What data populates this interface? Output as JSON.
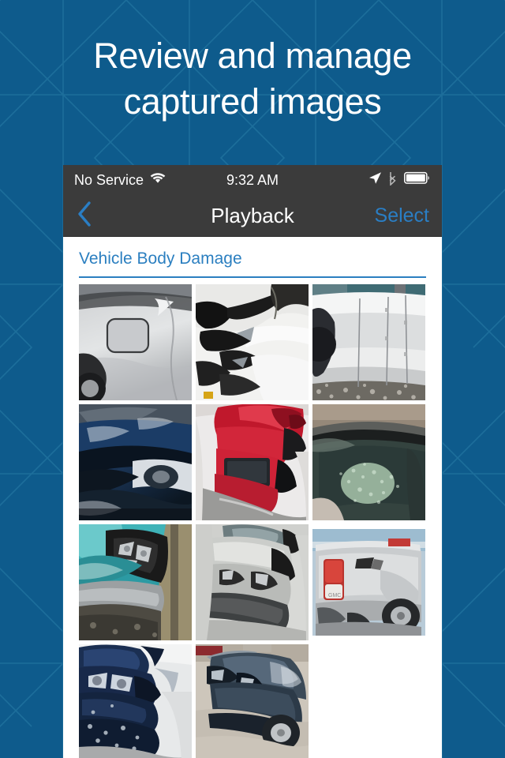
{
  "promo": {
    "headline_line1": "Review and manage",
    "headline_line2": "captured images",
    "background_color": "#0e5b8c",
    "pattern_line_color": "#2a7fa8"
  },
  "phone": {
    "status_bar": {
      "carrier": "No Service",
      "wifi_icon": "wifi-icon",
      "time": "9:32 AM",
      "location_icon": "location-arrow-icon",
      "bluetooth_icon": "bluetooth-icon",
      "battery_icon": "battery-full-icon",
      "background_color": "#3b3b3b"
    },
    "nav_bar": {
      "back_icon": "chevron-left-icon",
      "title": "Playback",
      "action_label": "Select",
      "accent_color": "#2a7ec4"
    },
    "content": {
      "section_title": "Vehicle Body Damage",
      "section_accent": "#2b7fc0",
      "thumbnails": [
        {
          "name": "silver-car-fuel-door-dent",
          "alt": "Silver car rear quarter panel dent near fuel door"
        },
        {
          "name": "white-car-front-crash",
          "alt": "White car severe front-end crash damage"
        },
        {
          "name": "white-car-side-panel-damage",
          "alt": "White vehicle crushed side panels on gravel"
        },
        {
          "name": "blue-car-hood-headlight",
          "alt": "Dark blue car hood and headlight damage"
        },
        {
          "name": "red-car-front-crush",
          "alt": "Red car crushed front bumper and hood"
        },
        {
          "name": "shattered-windshield",
          "alt": "Shattered windshield of dark car"
        },
        {
          "name": "teal-car-front-damage",
          "alt": "Teal car smashed front headlight area"
        },
        {
          "name": "silver-sedan-front-crush",
          "alt": "Silver sedan crushed front end"
        },
        {
          "name": "silver-pickup-rear-quarter",
          "alt": "Silver GMC pickup truck rear quarter damage"
        },
        {
          "name": "navy-car-front-damage",
          "alt": "Navy blue car destroyed front corner"
        },
        {
          "name": "gray-sedan-rear-quarter",
          "alt": "Dark gray sedan crushed rear quarter panel"
        }
      ]
    }
  }
}
